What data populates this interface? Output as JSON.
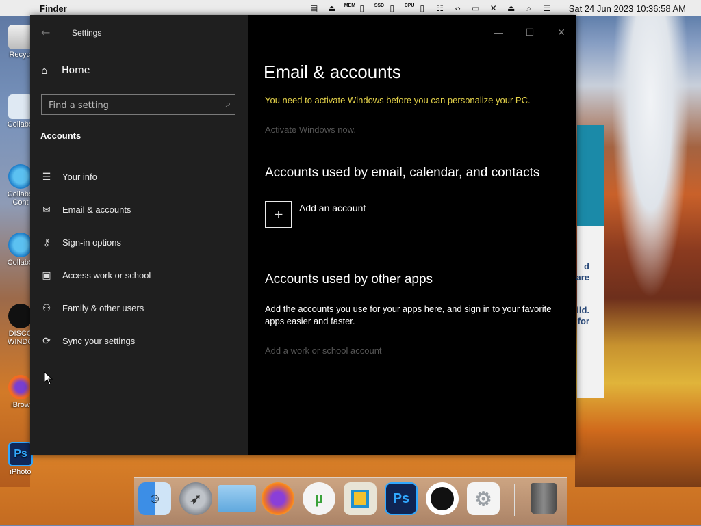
{
  "menubar": {
    "app_name": "Finder",
    "clock": "Sat 24 Jun 2023  10:36:58 AM",
    "status_icons": [
      "clipboard-icon",
      "eject-circle-icon",
      "memory-monitor-icon",
      "ssd-monitor-icon",
      "cpu-monitor-icon",
      "filmstrip-icon",
      "code-icon",
      "display-icon",
      "mute-icon",
      "eject-icon",
      "search-icon",
      "control-center-icon"
    ],
    "mem_label": "MEM",
    "ssd_label": "SSD",
    "cpu_label": "CPU"
  },
  "desktop": {
    "icons": [
      {
        "label": "Recycl"
      },
      {
        "label": "CollabS"
      },
      {
        "label": "CollabS Cont"
      },
      {
        "label": "CollabS"
      },
      {
        "label": "DISCO WINDO"
      },
      {
        "label": "iBrow"
      },
      {
        "label": "iPhoto"
      }
    ],
    "bg_text": [
      "d",
      "are",
      "ild.",
      "for"
    ]
  },
  "window": {
    "title": "Settings",
    "sidebar": {
      "home_label": "Home",
      "search_placeholder": "Find a setting",
      "section_title": "Accounts",
      "items": [
        {
          "label": "Your info",
          "icon": "person-card-icon"
        },
        {
          "label": "Email & accounts",
          "icon": "mail-icon"
        },
        {
          "label": "Sign-in options",
          "icon": "key-icon"
        },
        {
          "label": "Access work or school",
          "icon": "briefcase-icon"
        },
        {
          "label": "Family & other users",
          "icon": "person-add-icon"
        },
        {
          "label": "Sync your settings",
          "icon": "sync-icon"
        }
      ]
    },
    "main": {
      "heading": "Email & accounts",
      "activation_warning": "You need to activate Windows before you can personalize your PC.",
      "activate_link": "Activate Windows now.",
      "section1_heading": "Accounts used by email, calendar, and contacts",
      "add_account_label": "Add an account",
      "section2_heading": "Accounts used by other apps",
      "section2_text": "Add the accounts you use for your apps here, and sign in to your favorite apps easier and faster.",
      "work_account_link": "Add a work or school account"
    }
  },
  "dock": {
    "items": [
      {
        "name": "finder"
      },
      {
        "name": "launchpad"
      },
      {
        "name": "folder"
      },
      {
        "name": "firefox"
      },
      {
        "name": "utorrent"
      },
      {
        "name": "collab"
      },
      {
        "name": "photoshop",
        "text": "Ps"
      },
      {
        "name": "apple-app"
      },
      {
        "name": "system-preferences"
      },
      {
        "name": "trash"
      }
    ]
  }
}
